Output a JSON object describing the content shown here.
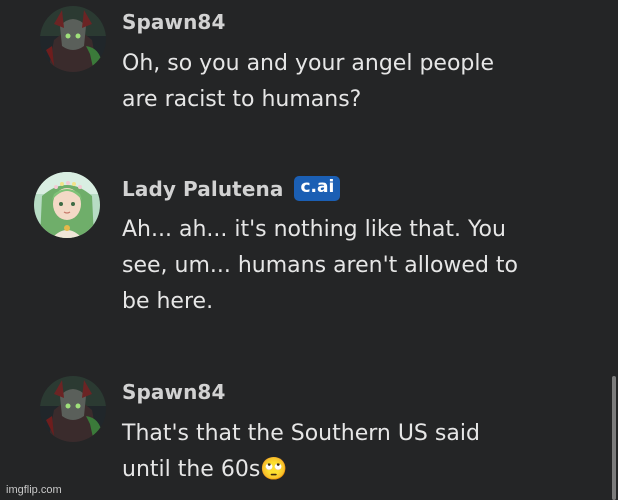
{
  "messages": [
    {
      "author": "Spawn84",
      "badge": "",
      "avatar_icon": "spawn-avatar",
      "text": "Oh, so you and your angel people\nare racist to humans?"
    },
    {
      "author": "Lady Palutena",
      "badge": "c.ai",
      "avatar_icon": "palutena-avatar",
      "text": "Ah... ah... it's nothing like that. You\nsee, um... humans aren't allowed to\nbe here."
    },
    {
      "author": "Spawn84",
      "badge": "",
      "avatar_icon": "spawn-avatar",
      "text": "That's that the Southern US said\nuntil the 60s🙄"
    }
  ],
  "watermark": "imgflip.com",
  "colors": {
    "background": "#242526",
    "badge": "#1b5fb4",
    "name": "#d2d2d2",
    "text": "#e6e6e6"
  }
}
